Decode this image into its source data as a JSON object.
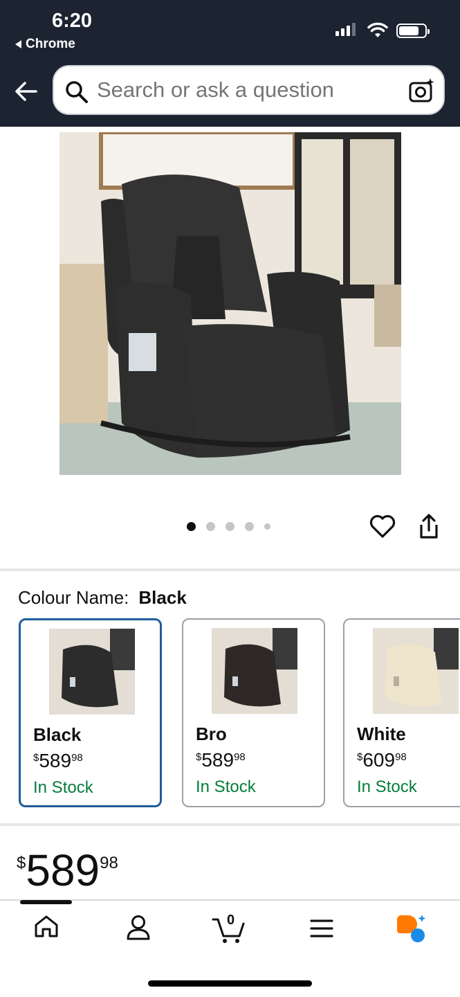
{
  "status_bar": {
    "time": "6:20",
    "back_app": "Chrome"
  },
  "search": {
    "placeholder": "Search or ask a question"
  },
  "gallery": {
    "image_count": 5,
    "active_index": 0
  },
  "colour": {
    "label": "Colour Name:",
    "selected": "Black"
  },
  "variants": [
    {
      "name": "Black",
      "symbol": "$",
      "whole": "589",
      "cents": "98",
      "stock": "In Stock"
    },
    {
      "name": "Bro",
      "symbol": "$",
      "whole": "589",
      "cents": "98",
      "stock": "In Stock"
    },
    {
      "name": "White",
      "symbol": "$",
      "whole": "609",
      "cents": "98",
      "stock": "In Stock"
    }
  ],
  "price": {
    "symbol": "$",
    "whole": "589",
    "cents": "98"
  },
  "tabbar": {
    "cart_count": "0",
    "items": [
      "home-icon",
      "account-icon",
      "cart-icon",
      "menu-icon",
      "rufus-icon"
    ]
  },
  "colors": {
    "header": "#1c2331",
    "selected_border": "#1f5c99",
    "stock_green": "#067d3b",
    "accent_orange": "#ff7a00",
    "accent_blue": "#1a8ce8"
  }
}
